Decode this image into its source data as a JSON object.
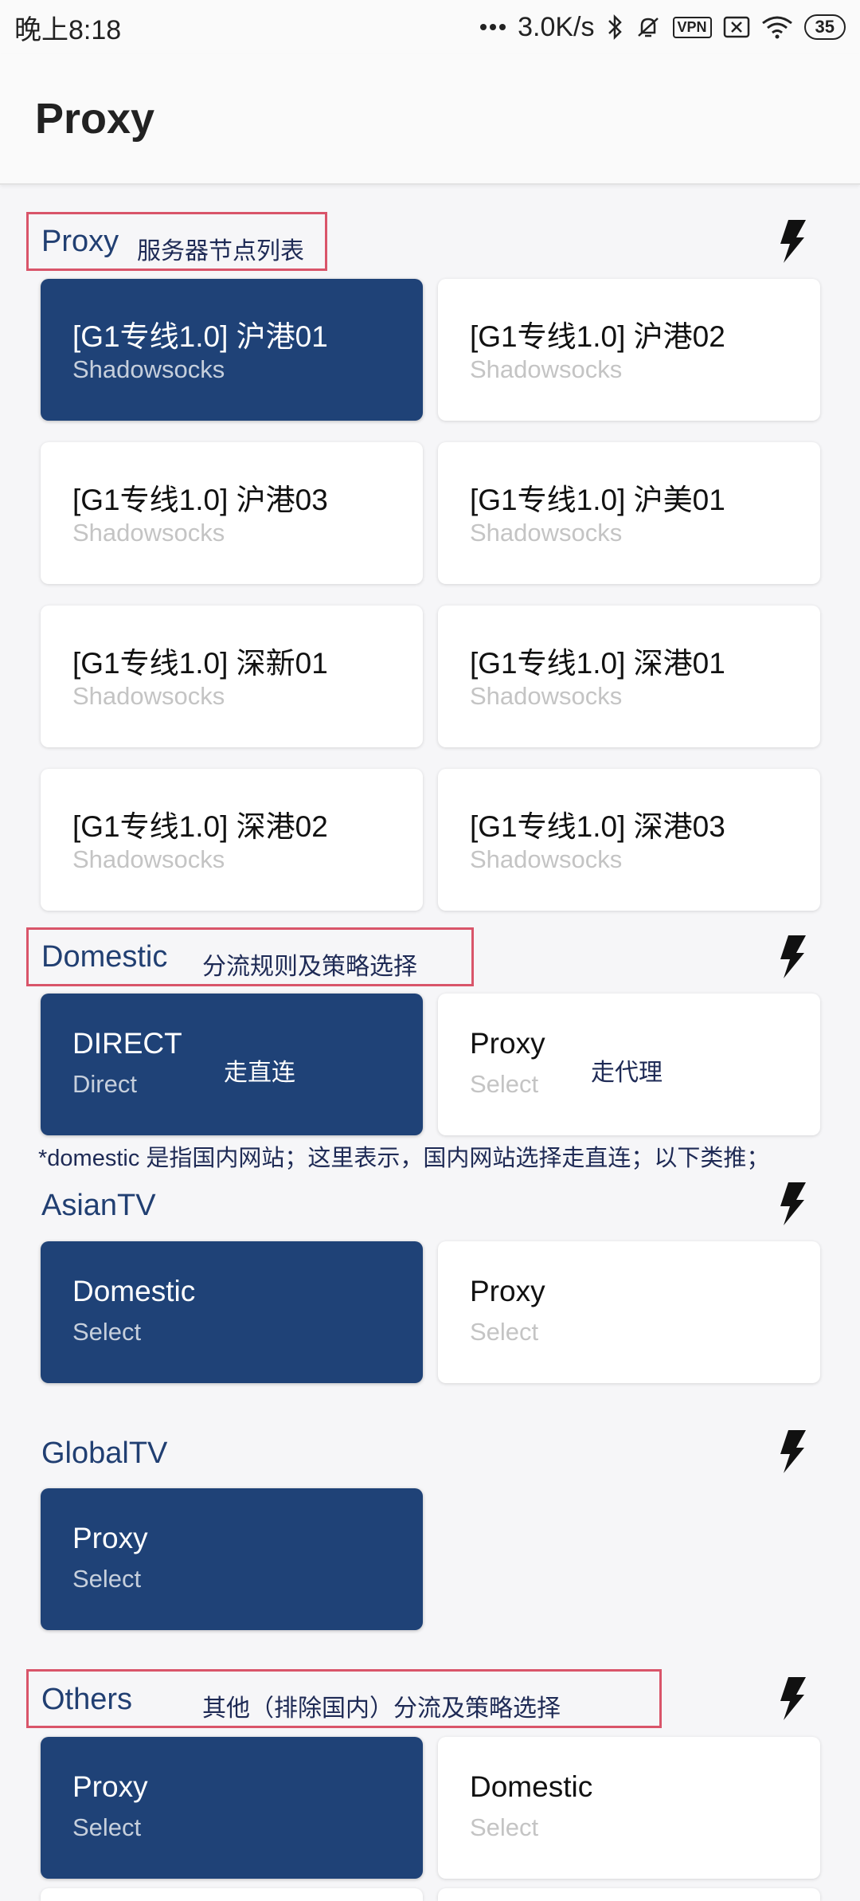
{
  "status_bar": {
    "time": "晚上8:18",
    "network_speed": "3.0K/s",
    "vpn_badge": "VPN",
    "battery": "35",
    "icons": [
      "signal-dots-icon",
      "bluetooth-icon",
      "mute-icon",
      "vpn-icon",
      "no-sim-icon",
      "wifi-icon",
      "battery-icon"
    ]
  },
  "header": {
    "title": "Proxy"
  },
  "sections": {
    "proxy": {
      "title": "Proxy",
      "annotation": "服务器节点列表",
      "cards": [
        {
          "name": "[G1专线1.0] 沪港01",
          "type": "Shadowsocks",
          "selected": true
        },
        {
          "name": "[G1专线1.0] 沪港02",
          "type": "Shadowsocks",
          "selected": false
        },
        {
          "name": "[G1专线1.0] 沪港03",
          "type": "Shadowsocks",
          "selected": false
        },
        {
          "name": "[G1专线1.0] 沪美01",
          "type": "Shadowsocks",
          "selected": false
        },
        {
          "name": "[G1专线1.0] 深新01",
          "type": "Shadowsocks",
          "selected": false
        },
        {
          "name": "[G1专线1.0] 深港01",
          "type": "Shadowsocks",
          "selected": false
        },
        {
          "name": "[G1专线1.0] 深港02",
          "type": "Shadowsocks",
          "selected": false
        },
        {
          "name": "[G1专线1.0] 深港03",
          "type": "Shadowsocks",
          "selected": false
        }
      ]
    },
    "domestic": {
      "title": "Domestic",
      "annotation": "分流规则及策略选择",
      "cards": [
        {
          "name": "DIRECT",
          "type": "Direct",
          "note": "走直连",
          "selected": true
        },
        {
          "name": "Proxy",
          "type": "Select",
          "note": "走代理",
          "selected": false
        }
      ],
      "footnote": "*domestic 是指国内网站；这里表示，国内网站选择走直连；以下类推；"
    },
    "asiantv": {
      "title": "AsianTV",
      "cards": [
        {
          "name": "Domestic",
          "type": "Select",
          "selected": true
        },
        {
          "name": "Proxy",
          "type": "Select",
          "selected": false
        }
      ]
    },
    "globaltv": {
      "title": "GlobalTV",
      "cards": [
        {
          "name": "Proxy",
          "type": "Select",
          "selected": true
        }
      ]
    },
    "others": {
      "title": "Others",
      "annotation": "其他（排除国内）分流及策略选择",
      "cards": [
        {
          "name": "Proxy",
          "type": "Select",
          "selected": true
        },
        {
          "name": "Domestic",
          "type": "Select",
          "selected": false
        }
      ]
    }
  },
  "colors": {
    "selected_card": "#1f4277",
    "section_title": "#213f72",
    "annotation_box": "#d9556a",
    "annotation_text": "#1e2a55"
  }
}
